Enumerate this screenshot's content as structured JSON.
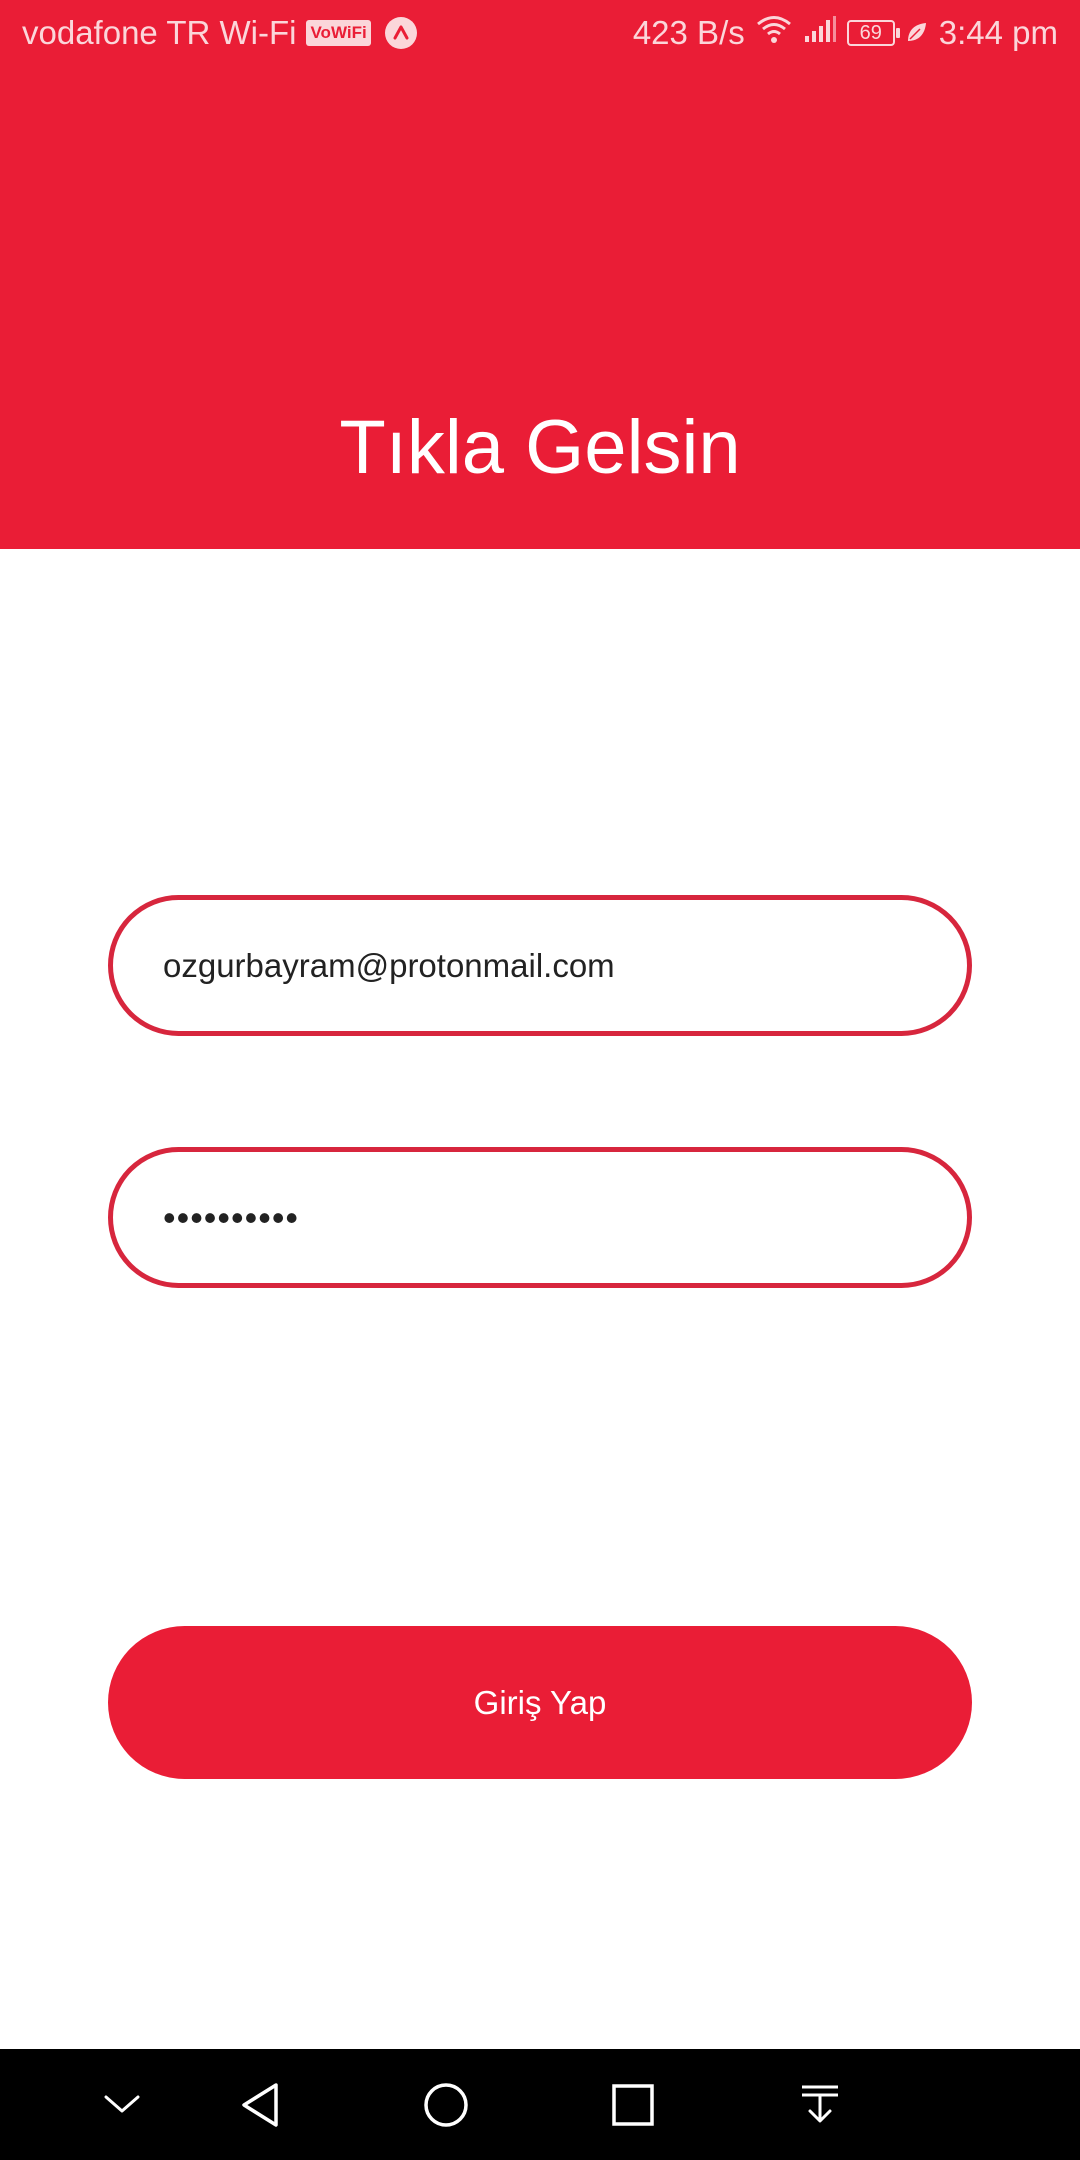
{
  "status_bar": {
    "carrier": "vodafone TR Wi-Fi",
    "vowifi_badge": "VoWiFi",
    "network_speed": "423 B/s",
    "battery_level": "69",
    "time": "3:44 pm"
  },
  "header": {
    "title": "Tıkla Gelsin"
  },
  "login_form": {
    "email_value": "ozgurbayram@protonmail.com",
    "password_value": "••••••••••",
    "submit_label": "Giriş Yap"
  },
  "colors": {
    "brand_red": "#EA1D36",
    "field_border": "#D7263D",
    "nav_bar": "#000000"
  },
  "icons": {
    "status": [
      "app-notification-icon",
      "wifi-icon",
      "signal-icon",
      "battery-icon",
      "battery-saver-leaf-icon"
    ],
    "navigation": [
      "collapse-chevron-icon",
      "back-icon",
      "home-icon",
      "recents-icon",
      "notification-pull-icon"
    ]
  }
}
